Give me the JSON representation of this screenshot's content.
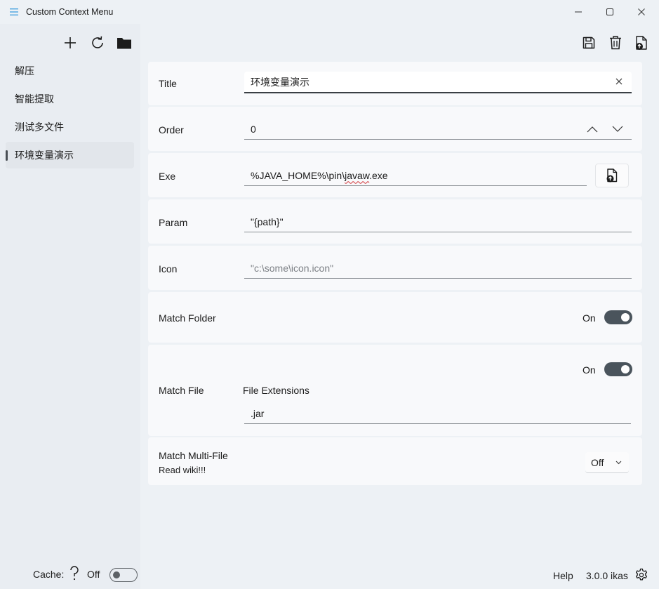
{
  "window": {
    "title": "Custom Context Menu"
  },
  "sidebar": {
    "toolbar": {
      "add_icon": "plus-icon",
      "refresh_icon": "refresh-icon",
      "folder_icon": "folder-icon"
    },
    "items": [
      {
        "label": "解压"
      },
      {
        "label": "智能提取"
      },
      {
        "label": "测试多文件"
      },
      {
        "label": "环境变量演示",
        "selected": true
      }
    ],
    "cache": {
      "label": "Cache:",
      "state": "Off"
    }
  },
  "toolbar": {
    "save_icon": "save-icon",
    "delete_icon": "trash-icon",
    "export_icon": "export-file-icon"
  },
  "form": {
    "title": {
      "label": "Title",
      "value": "环境变量演示"
    },
    "order": {
      "label": "Order",
      "value": "0"
    },
    "exe": {
      "label": "Exe",
      "value_prefix": "%JAVA_HOME%\\pin\\",
      "value_misspelled": "javaw",
      "value_suffix": ".exe"
    },
    "param": {
      "label": "Param",
      "value": "\"{path}\""
    },
    "icon": {
      "label": "Icon",
      "placeholder": "\"c:\\some\\icon.icon\""
    },
    "match_folder": {
      "label": "Match Folder",
      "state": "On"
    },
    "match_file": {
      "label": "Match File",
      "state": "On",
      "extensions_label": "File Extensions",
      "extensions_value": ".jar"
    },
    "match_multi": {
      "label": "Match Multi-File",
      "hint": "Read wiki!!!",
      "value": "Off"
    }
  },
  "footer": {
    "help": "Help",
    "version": "3.0.0 ikas"
  },
  "colors": {
    "toggle_on": "#4a545c",
    "misspelling": "#d13438"
  }
}
